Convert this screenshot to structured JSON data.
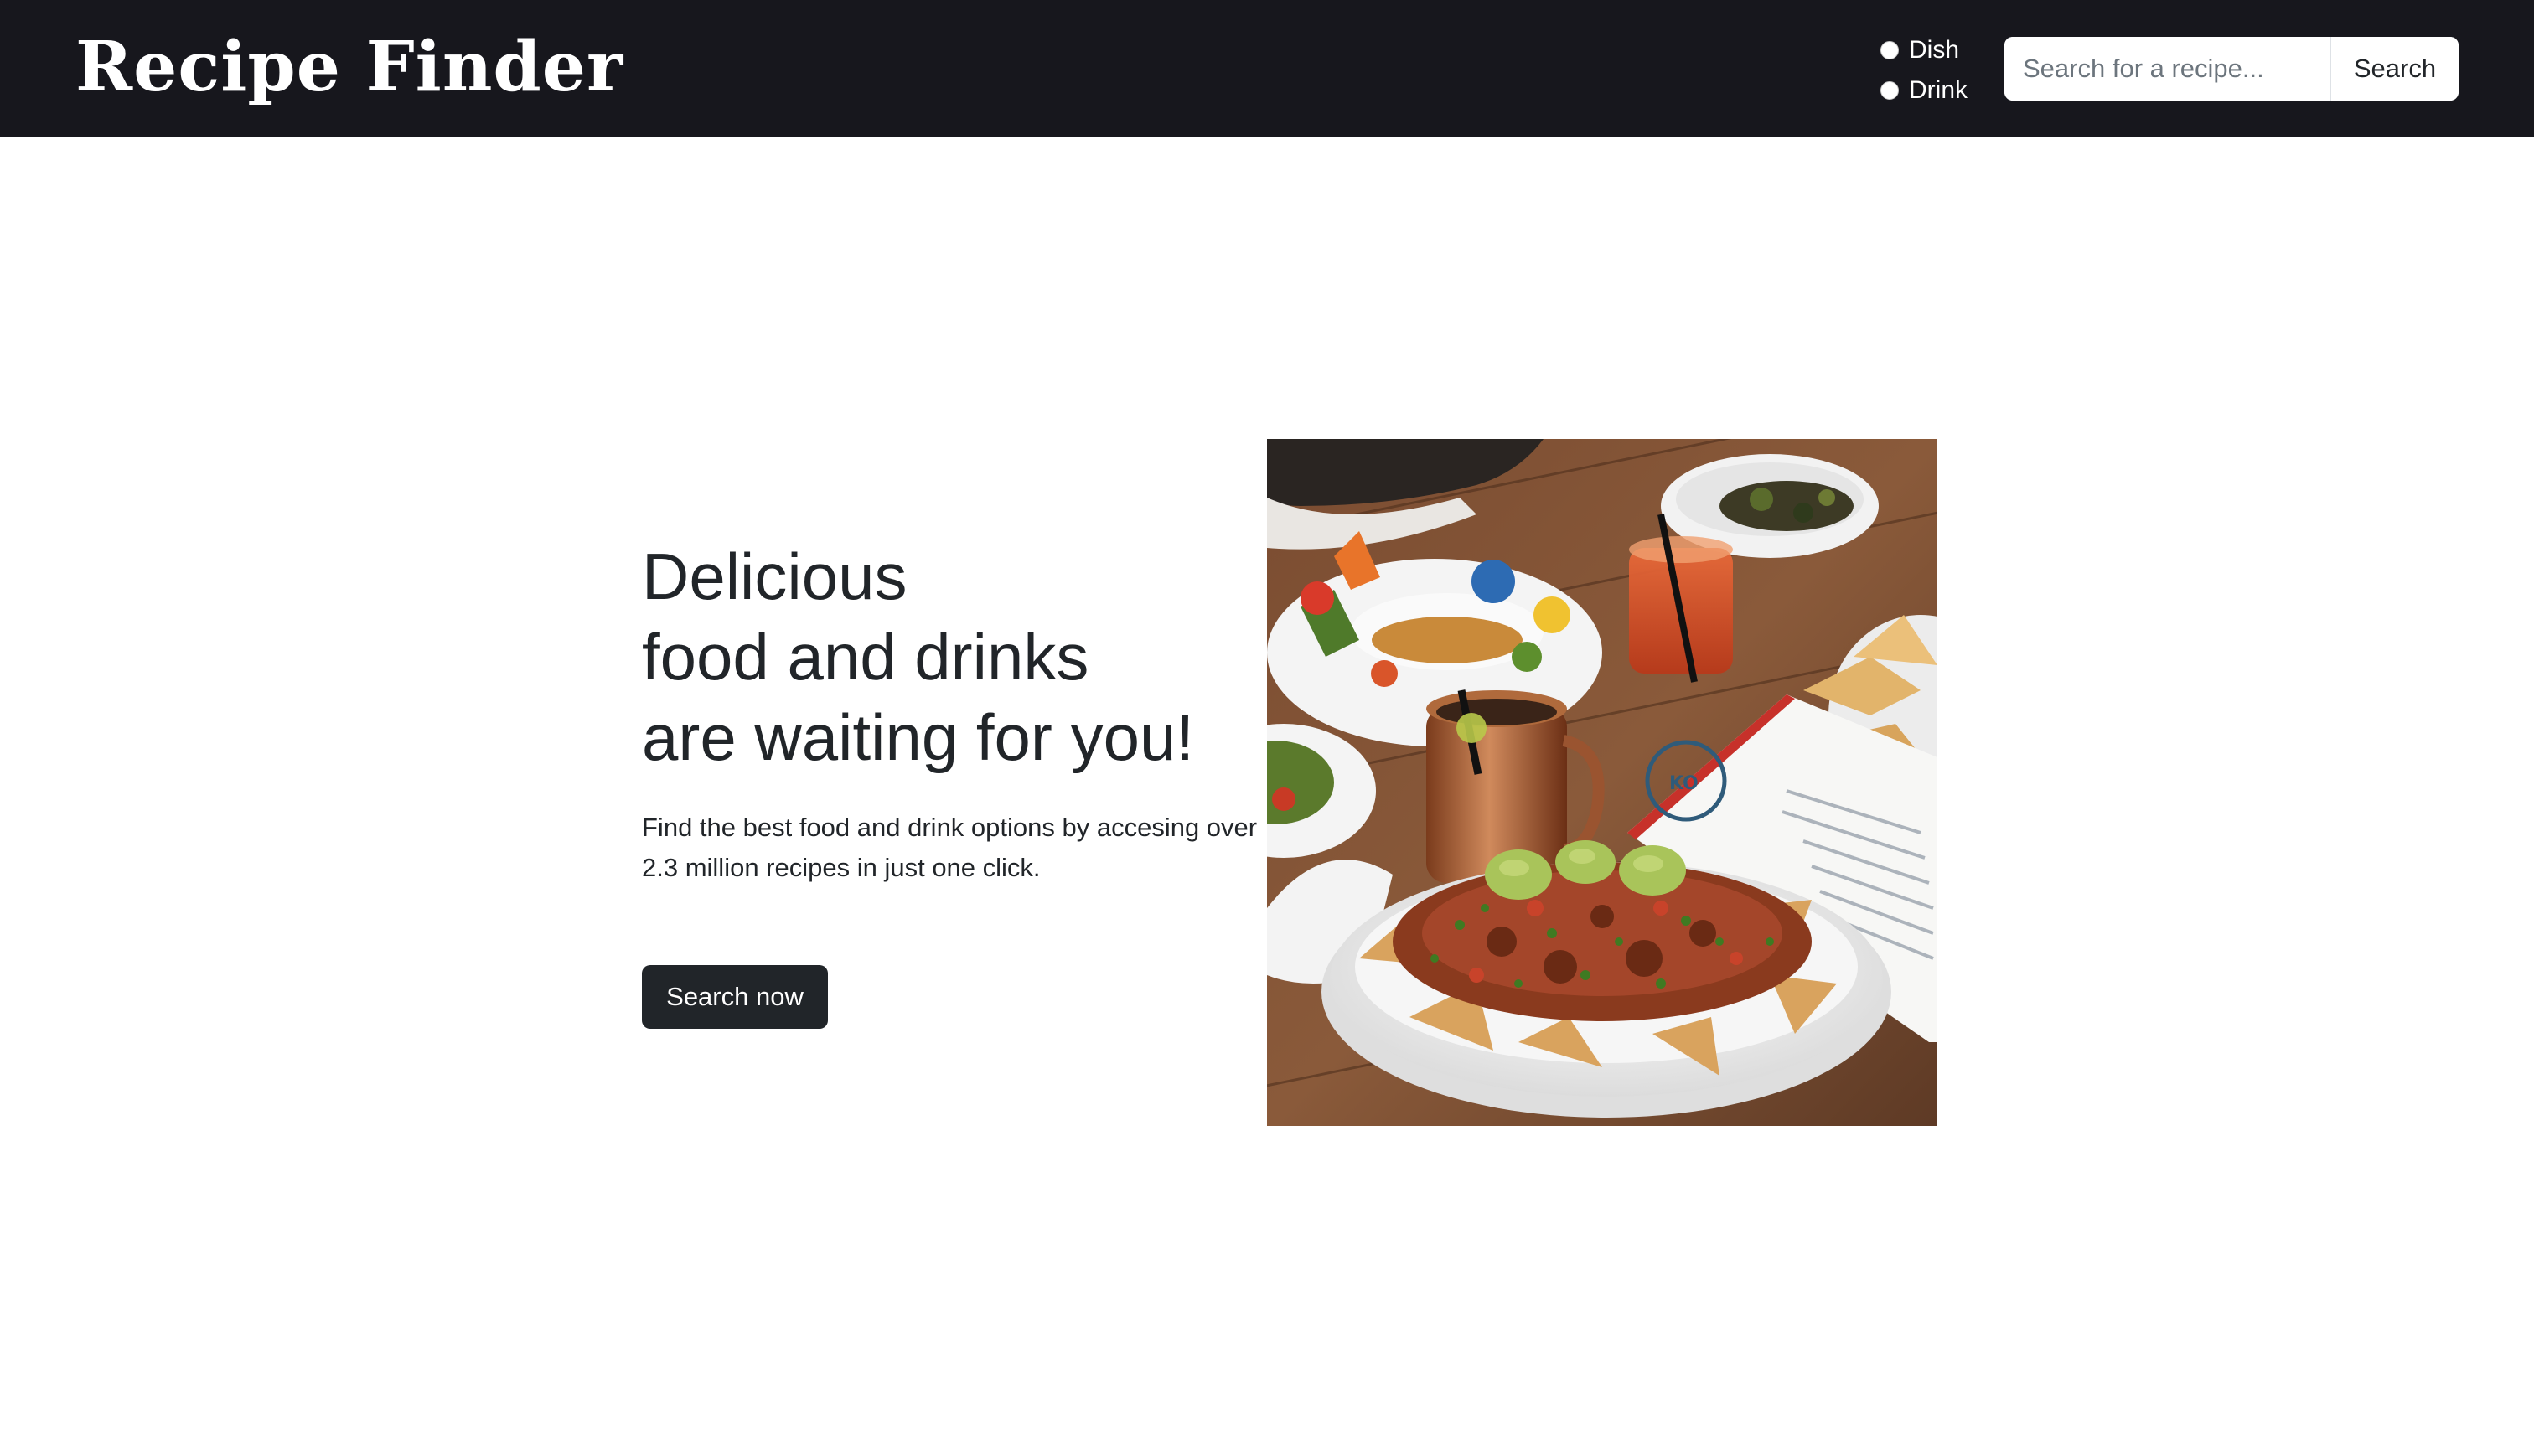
{
  "navbar": {
    "brand": "Recipe Finder",
    "search_type": {
      "options": [
        "Dish",
        "Drink"
      ]
    },
    "search": {
      "placeholder": "Search for a recipe...",
      "button_label": "Search"
    }
  },
  "hero": {
    "title_lines": [
      "Delicious",
      "food and drinks",
      "are waiting for you!"
    ],
    "description": "Find the best food and drink options by accesing over 2.3 million recipes in just one click.",
    "cta_label": "Search now",
    "image_subject": "nachos-plate-photo"
  },
  "colors": {
    "navbar_bg": "#17171d",
    "primary_button": "#212529",
    "text": "#212529"
  }
}
